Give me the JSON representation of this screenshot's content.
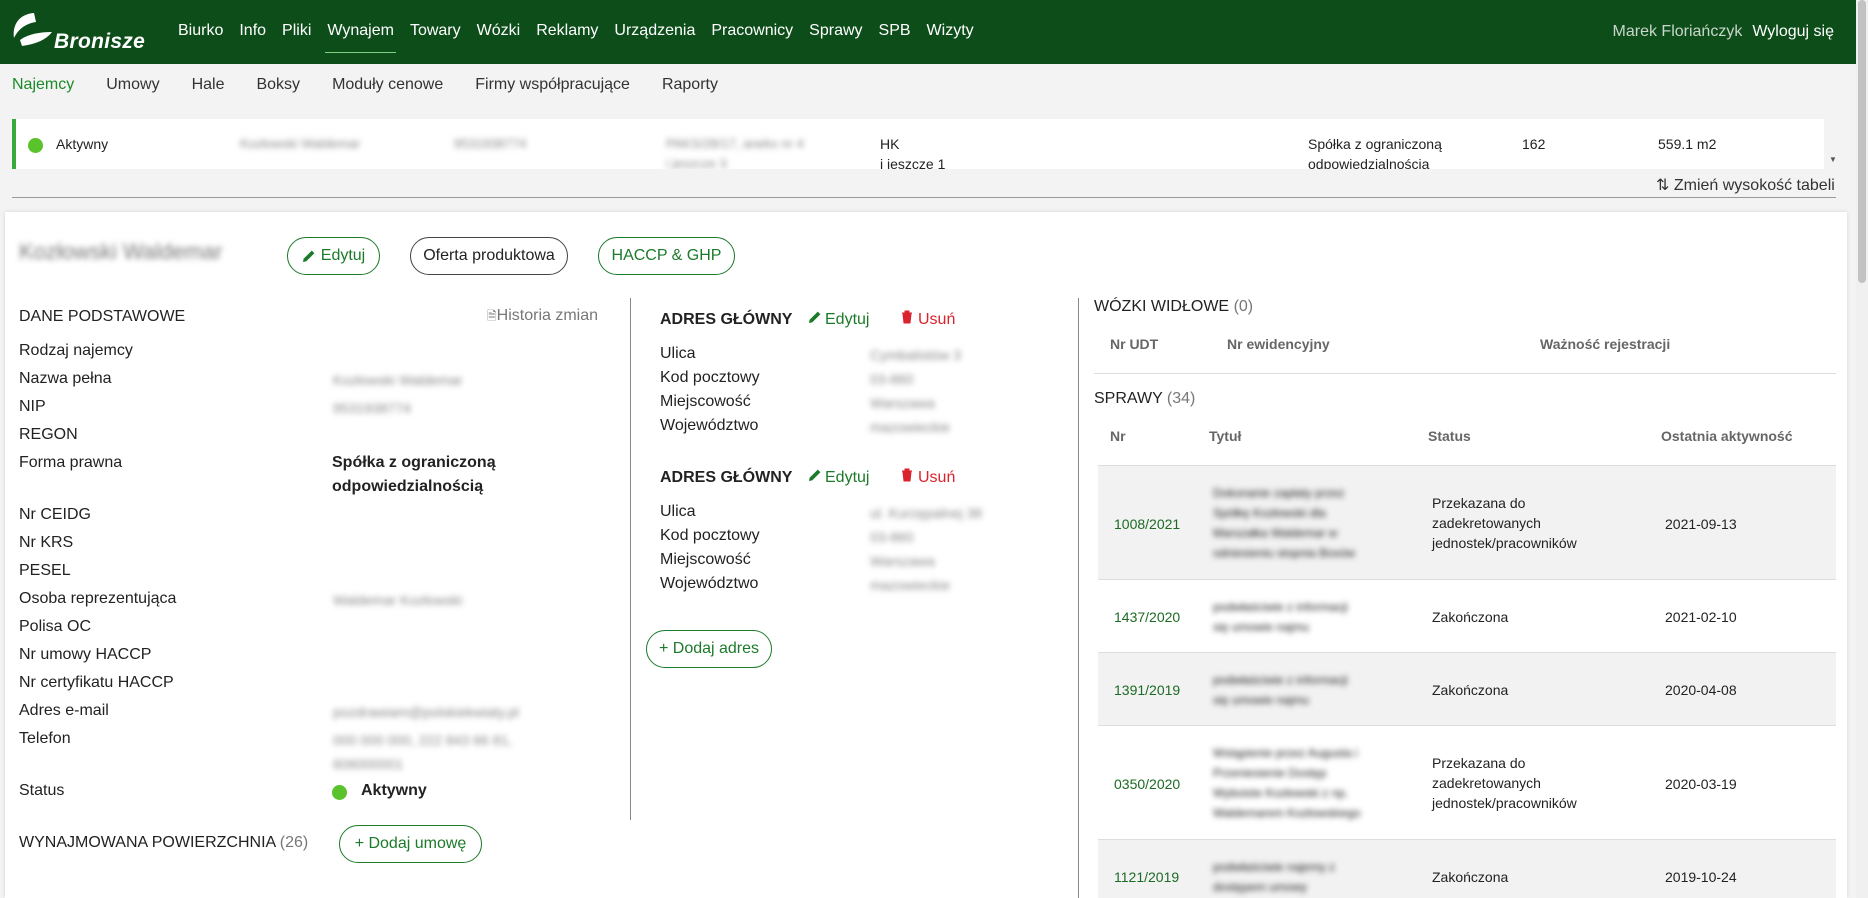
{
  "topbar": {
    "brand": "Bronisze",
    "nav": [
      "Biurko",
      "Info",
      "Pliki",
      "Wynajem",
      "Towary",
      "Wózki",
      "Reklamy",
      "Urządzenia",
      "Pracownicy",
      "Sprawy",
      "SPB",
      "Wizyty"
    ],
    "active_nav": "Wynajem",
    "user": "Marek Floriańczyk",
    "logout": "Wyloguj się"
  },
  "subnav": {
    "items": [
      "Najemcy",
      "Umowy",
      "Hale",
      "Boksy",
      "Moduły cenowe",
      "Firmy współpracujące",
      "Raporty"
    ],
    "active": "Najemcy"
  },
  "table_row": {
    "status": "Aktywny",
    "name": "Kozłowski Waldemar",
    "nip": "9531938774",
    "boxes": "PAKS/28/17, anekx nr 4",
    "boxes_more": "i jeszcze 3",
    "hall": "HK",
    "hall_more": "i jeszcze 1",
    "legal_form": "Spółka z ograniczoną",
    "legal_form2": "odpowiedzialnością",
    "count": "162",
    "area": "559.1 m2"
  },
  "resize_label": "⇅ Zmień wysokość tabeli",
  "detail": {
    "title": "Kozłowski Waldemar",
    "edit_button": "Edytuj",
    "offer_button": "Oferta produktowa",
    "haccp_button": "HACCP & GHP",
    "basic": {
      "heading": "DANE PODSTAWOWE",
      "history": "Historia zmian",
      "labels": {
        "rodzaj": "Rodzaj najemcy",
        "nazwa": "Nazwa pełna",
        "nip": "NIP",
        "regon": "REGON",
        "forma": "Forma prawna",
        "ceidg": "Nr CEIDG",
        "krs": "Nr KRS",
        "pesel": "PESEL",
        "osoba": "Osoba reprezentująca",
        "polisa": "Polisa OC",
        "umowa_haccp": "Nr umowy HACCP",
        "cert_haccp": "Nr certyfikatu HACCP",
        "email": "Adres e-mail",
        "telefon": "Telefon",
        "status": "Status"
      },
      "values": {
        "nazwa": "Kozłowski Waldemar",
        "nip": "9531938774",
        "forma1": "Spółka z ograniczoną",
        "forma2": "odpowiedzialnością",
        "osoba": "Waldemar Kozłowski",
        "email": "pozdrawiam@polskiekwiaty.pl",
        "telefon1": "000 000 000, 222 843 66 81,",
        "telefon2": "606000001",
        "status": "Aktywny"
      }
    },
    "lease": {
      "heading": "WYNAJMOWANA POWIERZCHNIA",
      "count": "(26)",
      "add_button": "+ Dodaj umowę"
    },
    "addresses": [
      {
        "heading": "ADRES GŁÓWNY",
        "edit": "Edytuj",
        "delete": "Usuń",
        "labels": [
          "Ulica",
          "Kod pocztowy",
          "Miejscowość",
          "Województwo"
        ],
        "values": [
          "Cymbalistów 3",
          "03-860",
          "Warszawa",
          "mazowieckie"
        ]
      },
      {
        "heading": "ADRES GŁÓWNY",
        "edit": "Edytuj",
        "delete": "Usuń",
        "labels": [
          "Ulica",
          "Kod pocztowy",
          "Miejscowość",
          "Województwo"
        ],
        "values": [
          "ul. Kurzępalnej 38",
          "03-860",
          "Warszawa",
          "mazowieckie"
        ]
      }
    ],
    "add_address": "+ Dodaj adres",
    "forklifts": {
      "heading": "WÓZKI WIDŁOWE",
      "count": "(0)",
      "columns": [
        "Nr UDT",
        "Nr ewidencyjny",
        "Ważność rejestracji"
      ]
    },
    "cases": {
      "heading": "SPRAWY",
      "count": "(34)",
      "columns": [
        "Nr",
        "Tytuł",
        "Status",
        "Ostatnia aktywność"
      ],
      "rows": [
        {
          "nr": "1008/2021",
          "title": [
            "Dokonanie zapłaty przez",
            "Spółkę Kozłowski dla",
            "Marszałka Waldemar w",
            "odniesieniu stopnia Boxów"
          ],
          "status": [
            "Przekazana do",
            "zadekretowanych",
            "jednostek/pracowników"
          ],
          "date": "2021-09-13"
        },
        {
          "nr": "1437/2020",
          "title": [
            "podwłaściwie z informacji",
            "się umowie najmu"
          ],
          "status": [
            "Zakończona"
          ],
          "date": "2021-02-10"
        },
        {
          "nr": "1391/2019",
          "title": [
            "podwłaściwie z informacji",
            "się umowie najmu"
          ],
          "status": [
            "Zakończona"
          ],
          "date": "2020-04-08"
        },
        {
          "nr": "0350/2020",
          "title": [
            "Wstąpienie przez Augusta i",
            "Przeniesienie Dostęp",
            "Wyboiste Kozłowski z np.",
            "Waldemarem Kozłowskiego"
          ],
          "status": [
            "Przekazana do",
            "zadekretowanych",
            "jednostek/pracowników"
          ],
          "date": "2020-03-19"
        },
        {
          "nr": "1121/2019",
          "title": [
            "podwłaściwie najemy z",
            "dostępem umowy"
          ],
          "status": [
            "Zakończona"
          ],
          "date": "2019-10-24"
        }
      ]
    }
  },
  "colors": {
    "header": "#0d4d1a",
    "accent": "#1c7a2a",
    "danger": "#d9232d",
    "status_dot": "#5ac22a"
  }
}
